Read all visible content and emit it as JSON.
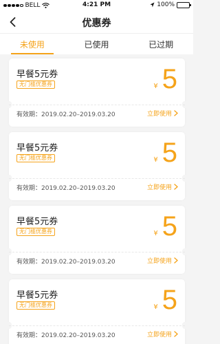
{
  "status_bar": {
    "carrier": "BELL",
    "time": "4:21 PM",
    "battery": "100%"
  },
  "header": {
    "title": "优惠券",
    "back_icon": "chevron-left-icon"
  },
  "tabs": [
    {
      "label": "未使用",
      "active": true
    },
    {
      "label": "已使用",
      "active": false
    },
    {
      "label": "已过期",
      "active": false
    }
  ],
  "coupons": [
    {
      "title": "早餐5元券",
      "tag": "无门槛优惠券",
      "currency": "¥",
      "amount": "5",
      "validity": "有效期：2019.02.20–2019.03.20",
      "action": "立即使用"
    },
    {
      "title": "早餐5元券",
      "tag": "无门槛优惠券",
      "currency": "¥",
      "amount": "5",
      "validity": "有效期：2019.02.20–2019.03.20",
      "action": "立即使用"
    },
    {
      "title": "早餐5元券",
      "tag": "无门槛优惠券",
      "currency": "¥",
      "amount": "5",
      "validity": "有效期：2019.02.20–2019.03.20",
      "action": "立即使用"
    },
    {
      "title": "早餐5元券",
      "tag": "无门槛优惠券",
      "currency": "¥",
      "amount": "5",
      "validity": "有效期：2019.02.20–2019.03.20",
      "action": "立即使用"
    }
  ],
  "colors": {
    "accent": "#f5a31a",
    "background": "#f4f4f4"
  }
}
